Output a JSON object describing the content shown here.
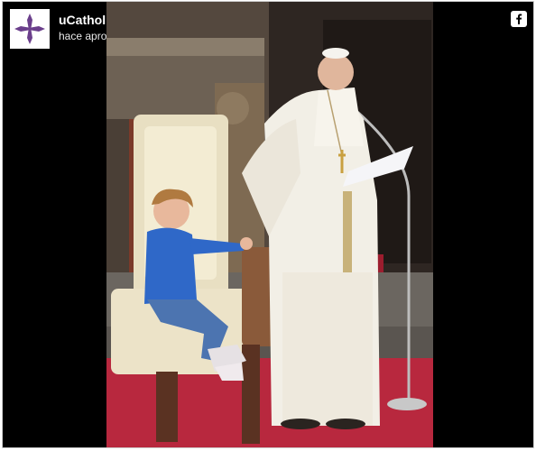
{
  "post": {
    "account_name": "uCatholic",
    "timestamp": "hace aproximadamente una semana",
    "verified": true,
    "avatar_icon": "purple-cross-icon",
    "share_icon": "facebook-icon"
  },
  "colors": {
    "background": "#000000",
    "avatar_cross": "#6b3f8c",
    "carpet": "#b8283e",
    "cassock": "#f2efe6"
  }
}
